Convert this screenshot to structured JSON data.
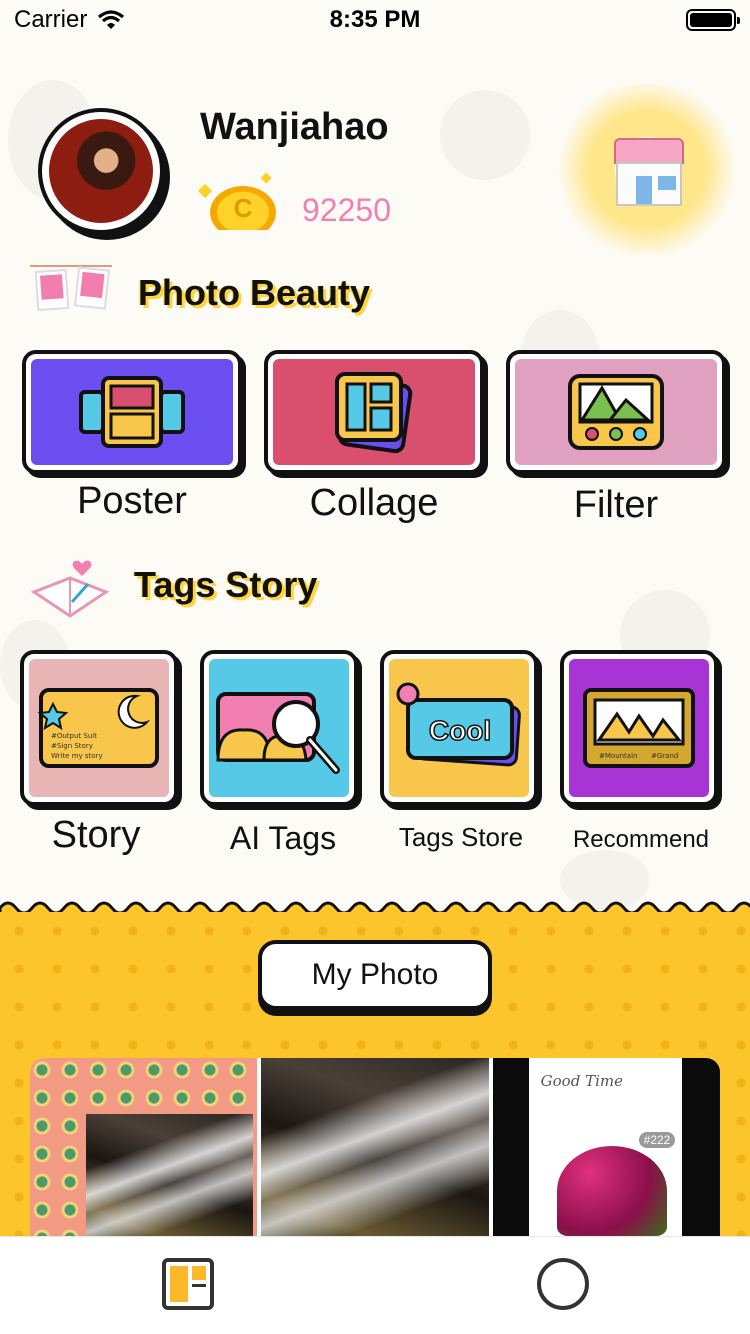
{
  "status_bar": {
    "carrier": "Carrier",
    "time": "8:35 PM"
  },
  "profile": {
    "username": "Wanjiahao",
    "coin_symbol": "C",
    "coin_count": "92250"
  },
  "sections": {
    "photo_beauty": {
      "title": "Photo Beauty",
      "tiles": [
        {
          "label": "Poster",
          "color": "#6a4ef0"
        },
        {
          "label": "Collage",
          "color": "#d9506f"
        },
        {
          "label": "Filter",
          "color": "#e0a2c0"
        }
      ]
    },
    "tags_story": {
      "title": "Tags Story",
      "tiles": [
        {
          "label": "Story",
          "color": "#e8b4b4"
        },
        {
          "label": "AI Tags",
          "color": "#56c9e7"
        },
        {
          "label": "Tags Store",
          "color": "#f7c64a"
        },
        {
          "label": "Recommend",
          "color": "#a834d6"
        }
      ]
    }
  },
  "tile_art": {
    "story_card_lines": [
      "#Output Suit",
      "#Sign Story",
      "Write my story"
    ],
    "cool_badge": "Cool",
    "recommend_tags": [
      "#Mountain",
      "#Grand"
    ]
  },
  "my_photo": {
    "button_label": "My Photo",
    "thumb_3_caption": "Good Time",
    "thumb_3_tag": "#222"
  },
  "colors": {
    "accent_yellow": "#fcc52c",
    "coin_pink": "#f27fb2"
  }
}
